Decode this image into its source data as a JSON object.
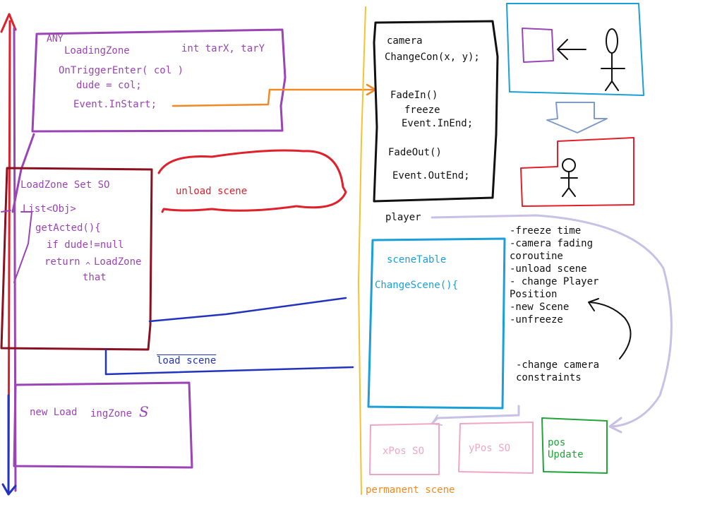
{
  "colors": {
    "purple": "#9b44b5",
    "red": "#e0202a",
    "darkred": "#8b1020",
    "blue": "#2233c0",
    "cyan": "#1a9fd8",
    "black": "#111111",
    "orange": "#f08a24",
    "yellow": "#f5c230",
    "pink": "#f0a6c4",
    "green": "#22a43a",
    "lavender": "#c8c0e6",
    "steel": "#7f9cc8"
  },
  "loading_zone": {
    "any": "ANY",
    "name": "LoadingZone",
    "fields": "int tarX, tarY",
    "trigger": "OnTriggerEnter( col )",
    "assign": "dude = col;",
    "event": "Event.InStart;"
  },
  "load_zone_set": {
    "title": "LoadZone Set SO",
    "list": "List<Obj>",
    "method": "getActed(){",
    "condition": "if dude!=null",
    "return_kw": "return",
    "return_val": "LoadZone",
    "that": "that"
  },
  "labels": {
    "unload_scene": "unload scene",
    "load_scene": "load scene",
    "new_loading_zone_a": "new Load",
    "new_loading_zone_b": "ingZone",
    "new_loading_zone_c": "S",
    "player": "player",
    "permanent_scene": "permanent scene"
  },
  "camera": {
    "title": "camera",
    "change": "ChangeCon(x, y);",
    "fade_in": "FadeIn()",
    "freeze": "freeze",
    "in_end": "Event.InEnd;",
    "fade_out": "FadeOut()",
    "out_end": "Event.OutEnd;"
  },
  "scene_table": {
    "title": "sceneTable",
    "method": "ChangeScene(){"
  },
  "steps": [
    "-freeze time",
    "-camera fading",
    "coroutine",
    "-unload scene",
    "- change Player",
    "Position",
    "-new Scene",
    "-unfreeze"
  ],
  "constraints": {
    "line1": "-change camera",
    "line2": "constraints"
  },
  "bottom_boxes": {
    "xpos": "xPos SO",
    "ypos": "yPos SO",
    "pos_line1": "pos",
    "pos_line2": "Update"
  }
}
